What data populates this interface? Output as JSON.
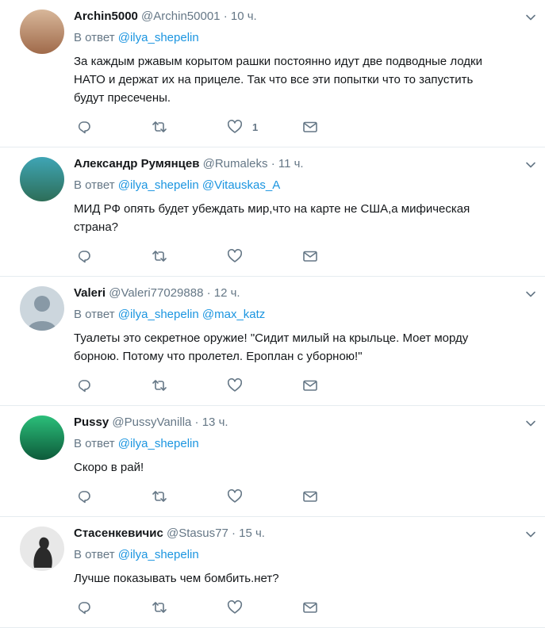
{
  "reply_prefix": "В ответ",
  "tweets": [
    {
      "name": "Archin5000",
      "handle": "@Archin50001",
      "dot": "·",
      "time": "10 ч.",
      "mentions": [
        "@ilya_shepelin"
      ],
      "text": "За каждым ржавым корытом рашки постоянно идут две подводные лодки\nНАТО и держат их на прицеле. Так что все эти попытки что то запустить\nбудут пресечены.",
      "likes": "1",
      "avatar_colors": [
        "#d8b79a",
        "#a06a4a"
      ]
    },
    {
      "name": "Александр Румянцев",
      "handle": "@Rumaleks",
      "dot": "·",
      "time": "11 ч.",
      "mentions": [
        "@ilya_shepelin",
        "@Vitauskas_A"
      ],
      "text": "МИД РФ опять будет убеждать мир,что на карте не США,а мифическая\nстрана?",
      "likes": "",
      "avatar_colors": [
        "#3fa5b5",
        "#2d6e58"
      ]
    },
    {
      "name": "Valeri",
      "handle": "@Valeri77029888",
      "dot": "·",
      "time": "12 ч.",
      "mentions": [
        "@ilya_shepelin",
        "@max_katz"
      ],
      "text": "Туалеты это секретное оружие! \"Сидит милый на крыльце. Моет морду\nборною. Потому что пролетел. Ероплан с уборною!\"",
      "likes": "",
      "avatar_colors": [
        "#ccd6dd",
        "#8899a6"
      ]
    },
    {
      "name": "Pussy",
      "handle": "@PussyVanilla",
      "dot": "·",
      "time": "13 ч.",
      "mentions": [
        "@ilya_shepelin"
      ],
      "text": "Скоро в рай!",
      "likes": "",
      "avatar_colors": [
        "#2bbf7a",
        "#0d5a3a"
      ]
    },
    {
      "name": "Стасенкевичис",
      "handle": "@Stasus77",
      "dot": "·",
      "time": "15 ч.",
      "mentions": [
        "@ilya_shepelin"
      ],
      "text": "Лучше показывать чем бомбить.нет?",
      "likes": "",
      "avatar_colors": [
        "#e8e8e8",
        "#2a2a2a"
      ]
    }
  ]
}
